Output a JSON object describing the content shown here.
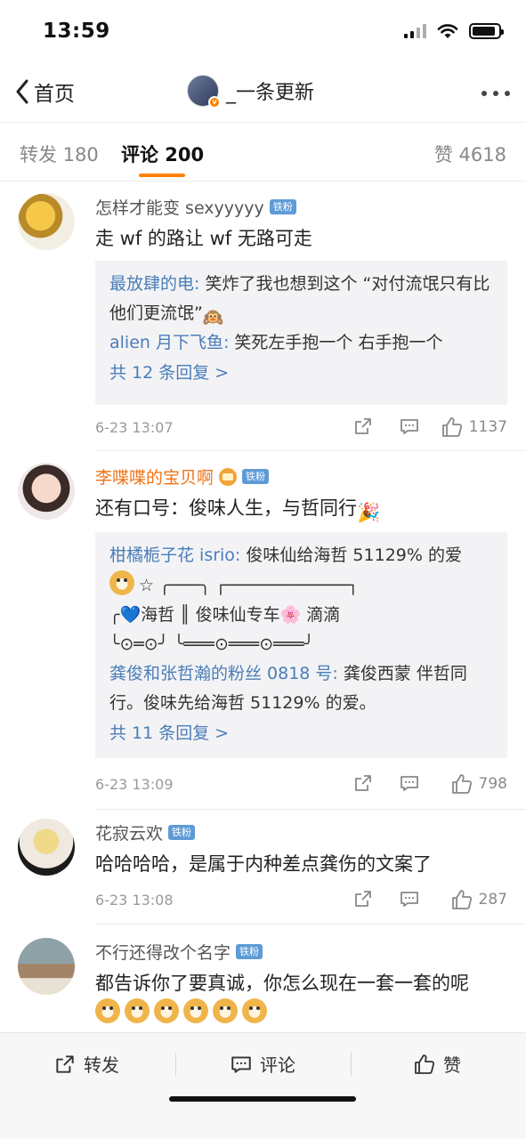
{
  "status": {
    "time": "13:59",
    "battery_level": 0.9
  },
  "nav": {
    "back_label": "首页",
    "title": "_一条更新"
  },
  "tabs": {
    "repost": "转发 180",
    "comments": "评论 200",
    "likes": "赞 4618"
  },
  "comments": [
    {
      "name": "怎样才能变 sexyyyyy",
      "badge": "铁粉",
      "text": "走 wf 的路让 wf 无路可走",
      "replies": [
        {
          "user": "最放肆的电:",
          "text": " 笑炸了我也想到这个 “对付流氓只有比他们更流氓”",
          "emoji": "🙉"
        },
        {
          "user": "alien 月下飞鱼:",
          "text": " 笑死左手抱一个 右手抱一个"
        }
      ],
      "more": "共 12 条回复 >",
      "time": "6-23 13:07",
      "likes": "1137"
    },
    {
      "name": "李喋喋的宝贝啊",
      "badge": "铁粉",
      "text": "还有口号：俊味人生，与哲同行",
      "text_emoji": "🎉",
      "replies": [
        {
          "user": "柑橘栀子花 isrio:",
          "text": " 俊味仙给海哲 51129% 的爱"
        },
        {
          "art_line1": "☆ ╭───╮ ┌────────────┐"
        },
        {
          "art_line2": "╭💙海哲 ║ 俊味仙专车🌸 滴滴"
        },
        {
          "art_line3": "╰⊙═⊙╯ ╰═══⊙═══⊙═══╯"
        },
        {
          "user": "龚俊和张哲瀚的粉丝 0818 号:",
          "text": " 龚俊西蒙 伴哲同行。俊味先给海哲 51129% 的爱。"
        }
      ],
      "more": "共 11 条回复 >",
      "time": "6-23 13:09",
      "likes": "798"
    },
    {
      "name": "花寂云欢",
      "badge": "铁粉",
      "text": "哈哈哈哈，是属于内种差点龚伤的文案了",
      "time": "6-23 13:08",
      "likes": "287"
    },
    {
      "name": "不行还得改个名字",
      "badge": "铁粉",
      "text": "都告诉你了要真诚，你怎么现在一套一套的呢"
    }
  ],
  "bottom": {
    "repost": "转发",
    "comment": "评论",
    "like": "赞"
  }
}
